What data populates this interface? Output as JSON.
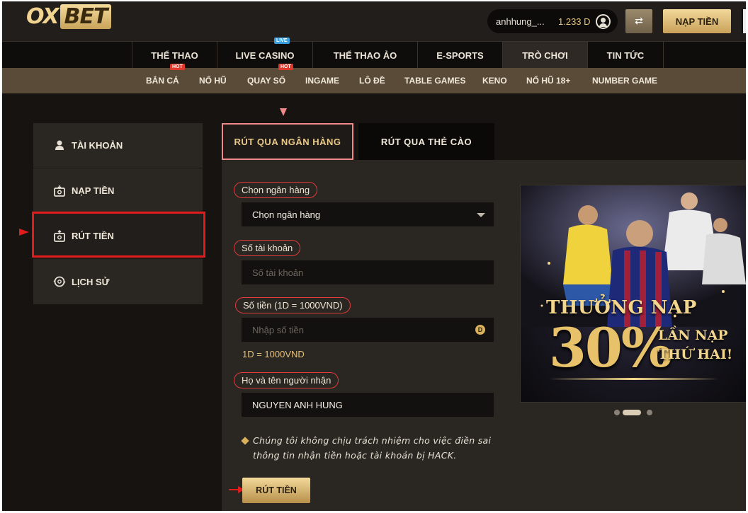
{
  "brand": {
    "logo_ox": "OX",
    "logo_bet": "BET"
  },
  "header": {
    "username": "anhhung_...",
    "balance": "1.233 D",
    "deposit_label": "NẠP TIỀN"
  },
  "nav": {
    "items": [
      {
        "label": "THỂ THAO"
      },
      {
        "label": "LIVE CASINO",
        "badge": "LIVE"
      },
      {
        "label": "THỂ THAO ẢO"
      },
      {
        "label": "E-SPORTS"
      },
      {
        "label": "TRÒ CHƠI",
        "active": true
      },
      {
        "label": "TIN TỨC"
      }
    ]
  },
  "subnav": {
    "items": [
      {
        "label": "BẮN CÁ",
        "badge": "HOT"
      },
      {
        "label": "NỔ HŨ"
      },
      {
        "label": "QUAY SỐ",
        "badge": "HOT"
      },
      {
        "label": "INGAME"
      },
      {
        "label": "LÔ ĐỀ"
      },
      {
        "label": "TABLE GAMES"
      },
      {
        "label": "KENO"
      },
      {
        "label": "NỔ HŨ 18+"
      },
      {
        "label": "NUMBER GAME"
      }
    ]
  },
  "side_menu": {
    "items": [
      {
        "label": "TÀI KHOẢN",
        "icon": "user-icon"
      },
      {
        "label": "NẠP TIỀN",
        "icon": "deposit-icon"
      },
      {
        "label": "RÚT TIỀN",
        "icon": "withdraw-icon",
        "active": true
      },
      {
        "label": "LỊCH SỬ",
        "icon": "history-icon"
      }
    ]
  },
  "tabs": {
    "bank": "RÚT QUA NGÂN HÀNG",
    "card": "RÚT QUA THẺ CÀO"
  },
  "form": {
    "bank_label": "Chọn ngân hàng",
    "bank_value": "Chọn ngân hàng",
    "account_label": "Số tài khoản",
    "account_placeholder": "Số tài khoản",
    "amount_label": "Số tiền (1D = 1000VND)",
    "amount_placeholder": "Nhập số tiền",
    "coin_symbol": "D",
    "rate_note": "1D = 1000VND",
    "name_label": "Họ và tên người nhận",
    "name_value": "NGUYEN ANH HUNG",
    "notice": "Chúng tôi không chịu trách nhiệm cho việc điền sai thông tin nhận tiền hoặc tài khoản bị HACK.",
    "submit_label": "RÚT TIỀN"
  },
  "banner": {
    "headline": "THƯỞNG NẠP",
    "percent": "30%",
    "sub_line1": "LẦN NẠP",
    "sub_line2": "THỨ HAI!",
    "slides": 3,
    "active_slide": 2
  },
  "colors": {
    "accent_gold": "#e9c98a",
    "highlight_red": "#e01c1c",
    "panel": "#2a2622",
    "background": "#161311"
  }
}
